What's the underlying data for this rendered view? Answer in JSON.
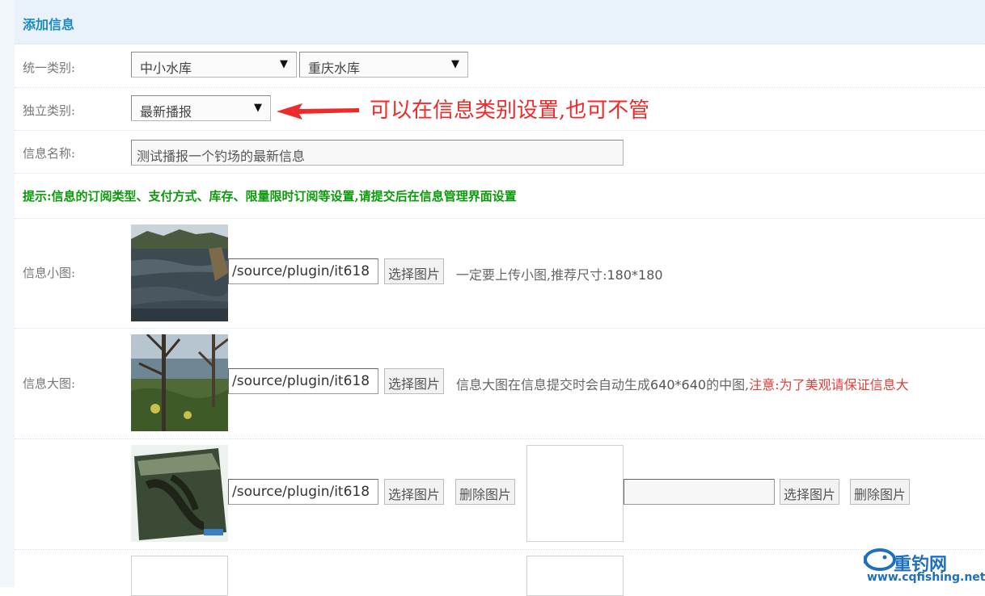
{
  "header": {
    "title": "添加信息"
  },
  "unified_category": {
    "label": "统一类别:",
    "primary_value": "中小水库",
    "secondary_value": "重庆水库"
  },
  "independent_category": {
    "label": "独立类别:",
    "value": "最新播报"
  },
  "info_name": {
    "label": "信息名称:",
    "value": "测试播报一个钓场的最新信息"
  },
  "tip": "提示:信息的订阅类型、支付方式、库存、限量限时订阅等设置,请提交后在信息管理界面设置",
  "annotation": "可以在信息类别设置,也可不管",
  "small_image": {
    "label": "信息小图:",
    "path": "/source/plugin/it618",
    "select_label": "选择图片",
    "hint_prefix": "一定要上传小图,推荐尺寸:",
    "hint_size": "180*180"
  },
  "large_image": {
    "label": "信息大图:",
    "path": "/source/plugin/it618",
    "select_label": "选择图片",
    "hint_prefix": "信息大图在信息提交时会自动生成",
    "hint_size": "640*640",
    "hint_suffix": "的中图,",
    "warning": "注意:为了美观请保证信息大"
  },
  "extra_image_1": {
    "path": "/source/plugin/it618",
    "select_label": "选择图片",
    "delete_label": "删除图片",
    "path2": "",
    "select_label_2": "选择图片",
    "delete_label_2": "删除图片"
  },
  "watermark": {
    "brand": "重钓网",
    "url": "www.cqfishing.net"
  },
  "colors": {
    "header_title": "#1c8bc0",
    "tip": "#0a9a0a",
    "annotation": "#ee2a2a",
    "warning": "#e0403a"
  }
}
